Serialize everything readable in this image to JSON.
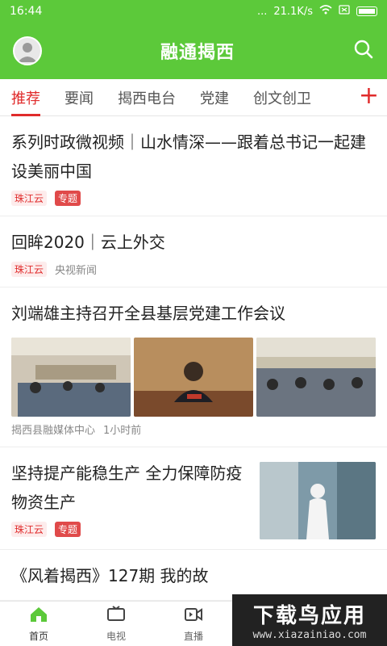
{
  "status": {
    "time": "16:44",
    "signal": "...",
    "speed": "21.1K/s"
  },
  "header": {
    "title": "融通揭西"
  },
  "tabs": [
    {
      "label": "推荐",
      "active": true
    },
    {
      "label": "要闻"
    },
    {
      "label": "揭西电台"
    },
    {
      "label": "党建"
    },
    {
      "label": "创文创卫"
    }
  ],
  "tab_add": "+",
  "articles": [
    {
      "title": "系列时政微视频｜山水情深——跟着总书记一起建设美丽中国",
      "source": "珠江云",
      "tag": "专题"
    },
    {
      "title": "回眸2020｜云上外交",
      "source": "珠江云",
      "publisher": "央视新闻"
    },
    {
      "title": "刘端雄主持召开全县基层党建工作会议",
      "publisher": "揭西县融媒体中心",
      "time": "1小时前"
    },
    {
      "title": "坚持提产能稳生产 全力保障防疫物资生产",
      "source": "珠江云",
      "tag": "专题"
    },
    {
      "title": "《风着揭西》127期 我的故"
    }
  ],
  "bottom_nav": [
    {
      "label": "首页",
      "icon": "home-icon",
      "active": true
    },
    {
      "label": "电视",
      "icon": "tv-icon"
    },
    {
      "label": "直播",
      "icon": "video-icon"
    }
  ],
  "watermark": {
    "main": "下载鸟应用",
    "sub": "www.xiazainiao.com"
  },
  "colors": {
    "brand": "#5cc93a",
    "accent": "#e02b2b"
  }
}
